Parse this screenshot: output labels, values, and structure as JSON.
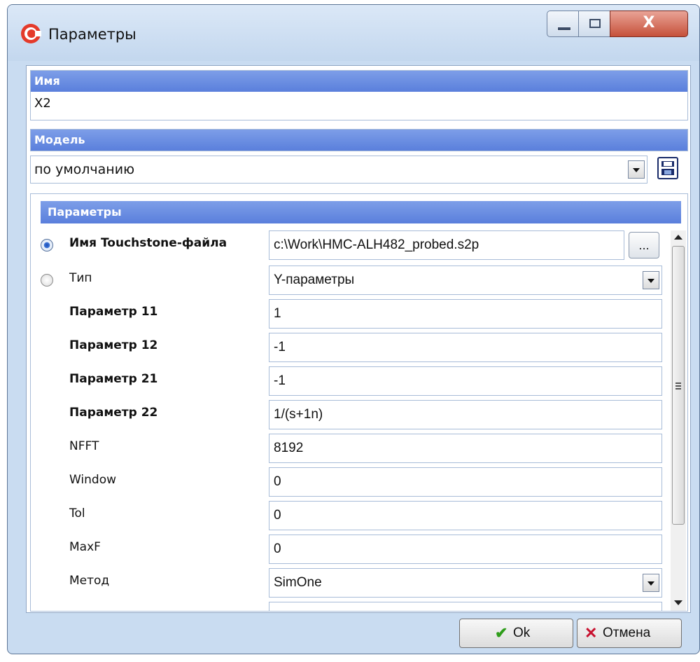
{
  "window": {
    "title": "Параметры",
    "close_glyph": "X"
  },
  "name_section": {
    "header": "Имя",
    "value": "X2"
  },
  "model_section": {
    "header": "Модель",
    "value": "по умолчанию"
  },
  "params_section": {
    "header": "Параметры",
    "touchstone": {
      "label": "Имя Touchstone-файла",
      "value": "c:\\Work\\HMC-ALH482_probed.s2p",
      "browse_label": "...",
      "selected": true
    },
    "type": {
      "label": "Тип",
      "value": "Y-параметры",
      "selected": false
    },
    "rows": [
      {
        "label": "Параметр 11",
        "value": "1"
      },
      {
        "label": "Параметр 12",
        "value": "-1"
      },
      {
        "label": "Параметр 21",
        "value": "-1"
      },
      {
        "label": "Параметр 22",
        "value": "1/(s+1n)"
      },
      {
        "label": "NFFT",
        "value": "8192"
      },
      {
        "label": "Window",
        "value": "0"
      },
      {
        "label": "Tol",
        "value": "0"
      },
      {
        "label": "MaxF",
        "value": "0"
      }
    ],
    "method": {
      "label": "Метод",
      "value": "SimOne"
    }
  },
  "buttons": {
    "ok_label": "Ok",
    "cancel_label": "Отмена",
    "ok_icon": "checkmark-icon",
    "cancel_icon": "cross-icon"
  },
  "colors": {
    "header": "#5a7fdc",
    "titlebar": "#c9dcf1",
    "close": "#c6513a",
    "ok_check": "#2e9d1a",
    "cancel_x": "#c8102e"
  }
}
